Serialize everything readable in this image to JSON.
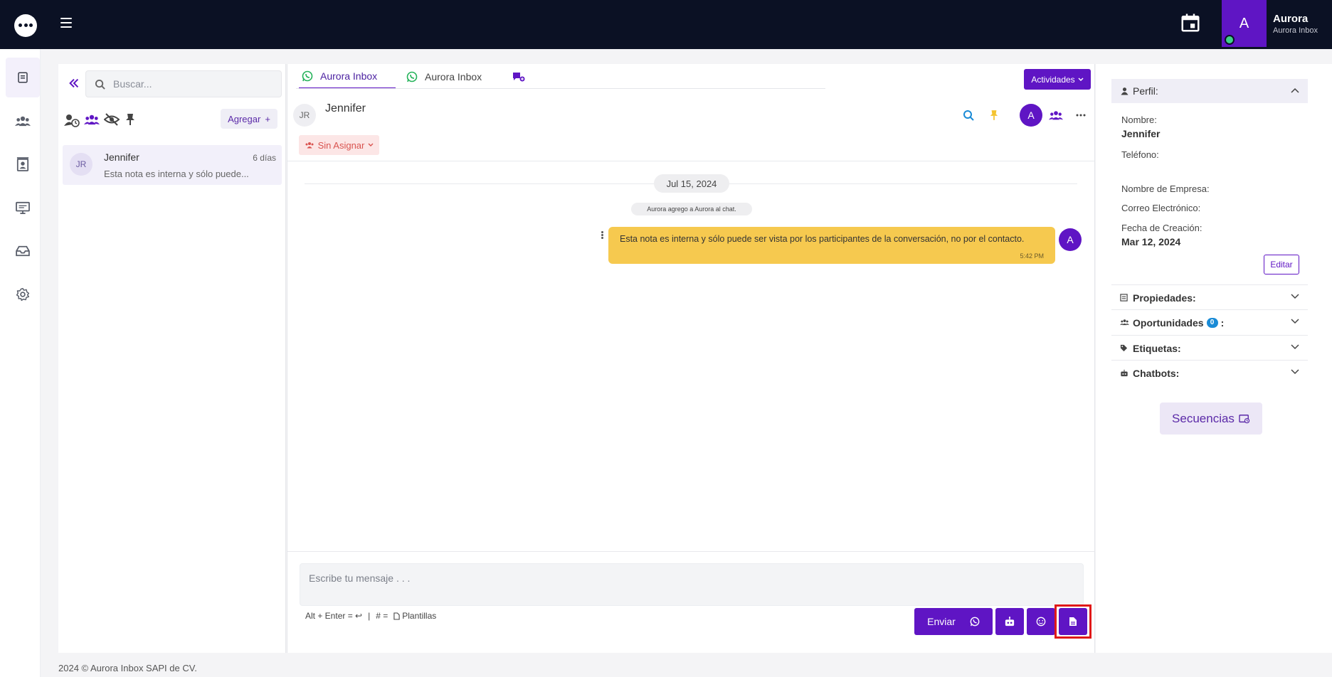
{
  "topbar": {
    "user_initial": "A",
    "user_name": "Aurora",
    "user_subtitle": "Aurora Inbox",
    "icons": [
      "chat-logo-icon",
      "hamburger-icon",
      "calendar-icon"
    ]
  },
  "leftnav": {
    "items": [
      "conversations-icon",
      "contacts-group-icon",
      "contact-card-icon",
      "monitor-icon",
      "inbox-tray-icon",
      "settings-gear-icon"
    ],
    "active": "conversations-icon"
  },
  "conversations": {
    "search_placeholder": "Buscar...",
    "add_label": "Agregar",
    "filters": [
      "assigned-user-icon",
      "team-icon",
      "hidden-icon",
      "pin-icon"
    ],
    "items": [
      {
        "initials": "JR",
        "name": "Jennifer",
        "time": "6 días",
        "preview": "Esta nota es interna y sólo puede..."
      }
    ]
  },
  "chat": {
    "tabs": [
      {
        "label": "Aurora Inbox",
        "icon": "whatsapp-icon",
        "active": true
      },
      {
        "label": "Aurora Inbox",
        "icon": "whatsapp-icon",
        "active": false
      },
      {
        "label": "",
        "icon": "new-chat-icon",
        "active": false
      }
    ],
    "actividades_label": "Actividades",
    "contact_initials": "JR",
    "contact_name": "Jennifer",
    "assign_label": "Sin Asignar",
    "assigned_initial": "A",
    "date_label": "Jul 15, 2024",
    "system_message": "Aurora agrego a Aurora al chat.",
    "message": {
      "text": "Esta nota es interna y sólo puede ser vista por los participantes de la conversación, no por el contacto.",
      "time": "5:42 PM",
      "author_initial": "A"
    },
    "composer_placeholder": "Escribe tu mensaje . . .",
    "hint_alt_enter": "Alt + Enter = ↩",
    "hint_separator": "|",
    "hint_hash": "# =",
    "hint_templates": "Plantillas",
    "send_label": "Enviar"
  },
  "profile": {
    "section_title": "Perfil:",
    "nombre_label": "Nombre:",
    "nombre_value": "Jennifer",
    "telefono_label": "Teléfono:",
    "empresa_label": "Nombre de Empresa:",
    "correo_label": "Correo Electrónico:",
    "fecha_label": "Fecha de Creación:",
    "fecha_value": "Mar 12, 2024",
    "editar_label": "Editar",
    "propiedades_label": "Propiedades:",
    "oportunidades_label": "Oportunidades",
    "oportunidades_count": "0",
    "oportunidades_suffix": ":",
    "etiquetas_label": "Etiquetas:",
    "chatbots_label": "Chatbots:",
    "secuencias_label": "Secuencias"
  },
  "footer": {
    "text": "2024 © Aurora Inbox SAPI de CV."
  },
  "colors": {
    "primary": "#5f15c4",
    "topbar": "#0b1124",
    "message_bg": "#f6c94f",
    "highlight": "#e01818"
  }
}
